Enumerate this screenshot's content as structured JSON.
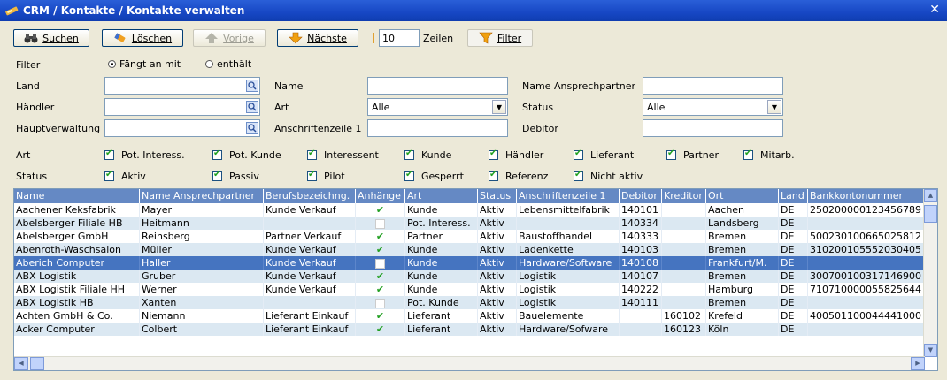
{
  "window": {
    "title": "CRM / Kontakte / Kontakte verwalten",
    "close_glyph": "✕"
  },
  "toolbar": {
    "search_label": "Suchen",
    "delete_label": "Löschen",
    "prev_label": "Vorige",
    "next_label": "Nächste",
    "rows_value": "10",
    "rows_label": "Zeilen",
    "filter_label": "Filter"
  },
  "filter": {
    "label": "Filter",
    "mode_starts": "Fängt an mit",
    "mode_contains": "enthält",
    "selected_mode": "starts"
  },
  "form": {
    "land_label": "Land",
    "haendler_label": "Händler",
    "hauptverwaltung_label": "Hauptverwaltung",
    "name_label": "Name",
    "art_label": "Art",
    "art_value": "Alle",
    "anschrift_label": "Anschriftenzeile 1",
    "ansprechpartner_label": "Name Ansprechpartner",
    "status_label": "Status",
    "status_value": "Alle",
    "debitor_label": "Debitor"
  },
  "art_checks": {
    "label": "Art",
    "items": [
      "Pot. Interess.",
      "Pot. Kunde",
      "Interessent",
      "Kunde",
      "Händler",
      "Lieferant",
      "Partner",
      "Mitarb."
    ]
  },
  "status_checks": {
    "label": "Status",
    "items": [
      "Aktiv",
      "Passiv",
      "Pilot",
      "Gesperrt",
      "Referenz",
      "Nicht aktiv"
    ]
  },
  "grid": {
    "columns": [
      "Name",
      "Name Ansprechpartner",
      "Berufsbezeichng.",
      "Anhänge",
      "Art",
      "Status",
      "Anschriftenzeile 1",
      "Debitor",
      "Kreditor",
      "Ort",
      "Land",
      "Bankkontonummer"
    ],
    "rows": [
      [
        "Aachener Keksfabrik",
        "Mayer",
        "Kunde Verkauf",
        "check",
        "Kunde",
        "Aktiv",
        "Lebensmittelfabrik",
        "140101",
        "",
        "Aachen",
        "DE",
        "250200000123456789"
      ],
      [
        "Abelsberger Filiale HB",
        "Heitmann",
        "",
        "empty",
        "Pot. Interess.",
        "Aktiv",
        "",
        "140334",
        "",
        "Landsberg",
        "DE",
        ""
      ],
      [
        "Abelsberger GmbH",
        "Reinsberg",
        "Partner Verkauf",
        "check",
        "Partner",
        "Aktiv",
        "Baustoffhandel",
        "140333",
        "",
        "Bremen",
        "DE",
        "500230100665025812"
      ],
      [
        "Abenroth-Waschsalon",
        "Müller",
        "Kunde Verkauf",
        "check",
        "Kunde",
        "Aktiv",
        "Ladenkette",
        "140103",
        "",
        "Bremen",
        "DE",
        "310200105552030405"
      ],
      [
        "Aberich Computer",
        "Haller",
        "Kunde Verkauf",
        "empty",
        "Kunde",
        "Aktiv",
        "Hardware/Software",
        "140108",
        "",
        "Frankfurt/M.",
        "DE",
        ""
      ],
      [
        "ABX Logistik",
        "Gruber",
        "Kunde Verkauf",
        "check",
        "Kunde",
        "Aktiv",
        "Logistik",
        "140107",
        "",
        "Bremen",
        "DE",
        "300700100317146900"
      ],
      [
        "ABX Logistik Filiale HH",
        "Werner",
        "Kunde Verkauf",
        "check",
        "Kunde",
        "Aktiv",
        "Logistik",
        "140222",
        "",
        "Hamburg",
        "DE",
        "710710000055825644"
      ],
      [
        "ABX Logistik HB",
        "Xanten",
        "",
        "empty",
        "Pot. Kunde",
        "Aktiv",
        "Logistik",
        "140111",
        "",
        "Bremen",
        "DE",
        ""
      ],
      [
        "Achten GmbH & Co.",
        "Niemann",
        "Lieferant Einkauf",
        "check",
        "Lieferant",
        "Aktiv",
        "Bauelemente",
        "",
        "160102",
        "Krefeld",
        "DE",
        "400501100044441000"
      ],
      [
        "Acker Computer",
        "Colbert",
        "Lieferant Einkauf",
        "check",
        "Lieferant",
        "Aktiv",
        "Hardware/Sofware",
        "",
        "160123",
        "Köln",
        "DE",
        ""
      ]
    ],
    "selected_row": 4
  },
  "colors": {
    "titlebar": "#1747c4",
    "header": "#6589c4",
    "selected": "#4574c0",
    "alt_row": "#dbe8f2",
    "panel": "#ece9d8"
  }
}
